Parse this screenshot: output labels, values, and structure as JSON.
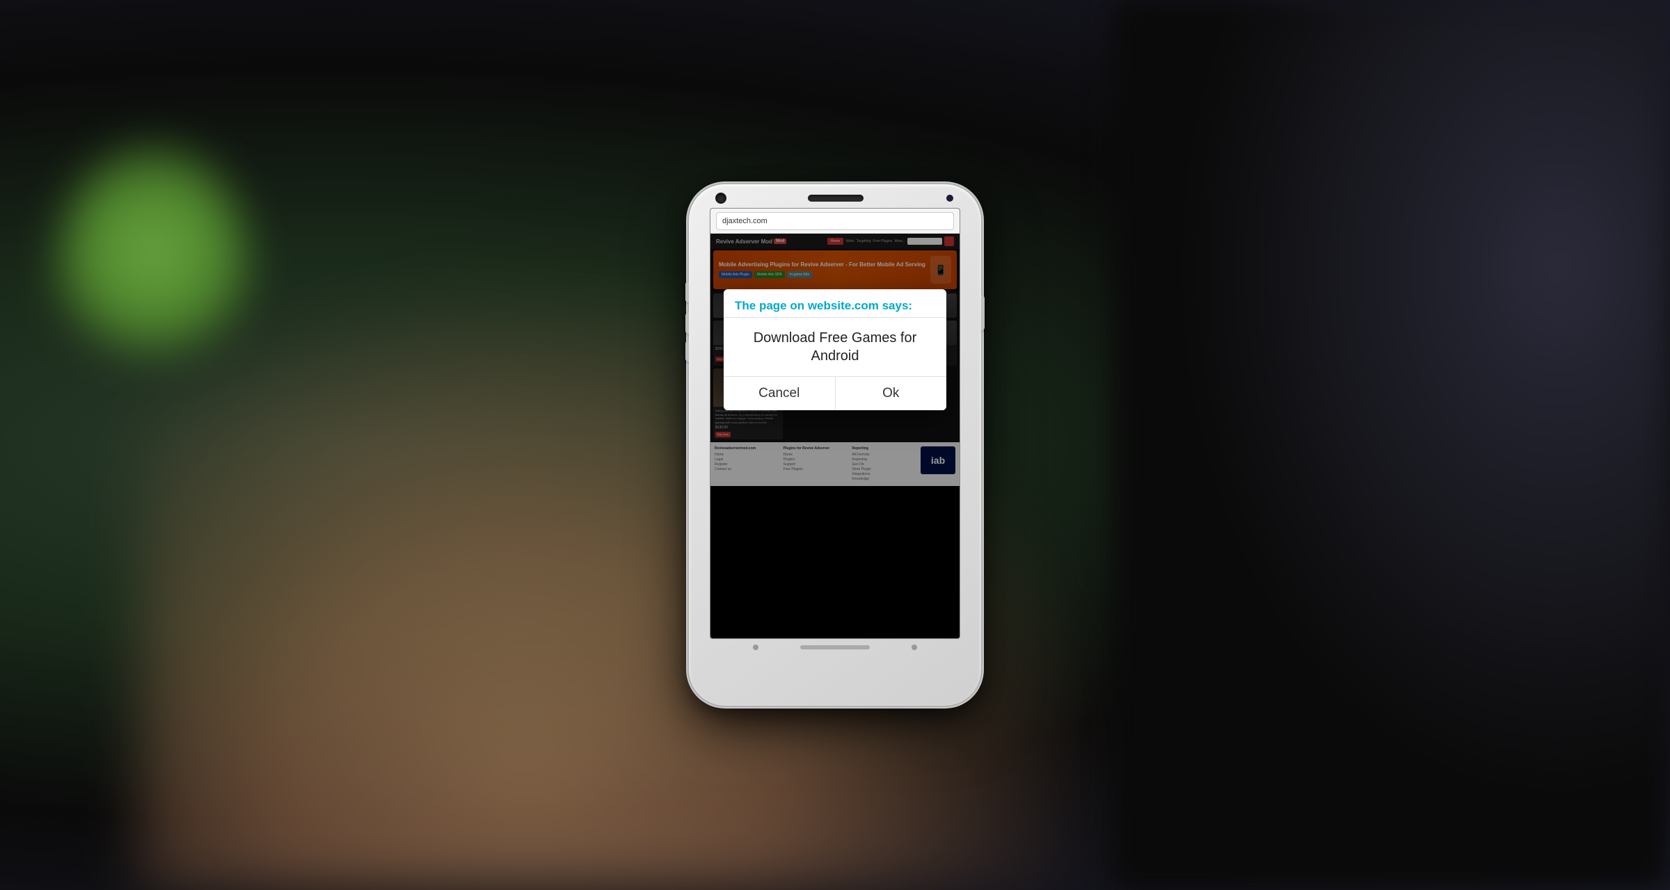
{
  "background": {
    "color": "#1a1a1a"
  },
  "phone": {
    "browser": {
      "address_bar": "djaxtech.com"
    },
    "website": {
      "header": {
        "logo_text": "Revive Adserver Mod",
        "logo_sub": "Plugins for Revive Adserver",
        "badge_text": "Mod",
        "nav_items": [
          "Home",
          "Video",
          "Targeting",
          "Free Plugins",
          "More..."
        ]
      },
      "banner": {
        "title": "Mobile Advertising Plugins for Revive Adserver - For Better Mobile Ad Serving",
        "btn1": "Mobile Ads Plugin",
        "btn2": "Mobile Ads SDK",
        "btn3": "In-game Ads"
      },
      "dialog": {
        "title": "The page on website.com says:",
        "message": "Download Free Games for Android",
        "cancel_label": "Cancel",
        "ok_label": "Ok"
      },
      "footer": {
        "col1_title": "Reviveadservermod.com",
        "col1_links": [
          "Home",
          "Legal",
          "Register",
          "Contact us"
        ],
        "col2_title": "Plugins for Revive Adserver",
        "col2_links": [
          "Home",
          "Plugins",
          "Support",
          "Free Plugins"
        ],
        "col3_title": "Reporting",
        "col3_links": [
          "All Formats",
          "Reporting",
          "Geo Db",
          "Store Plugin",
          "Integrations",
          "Knowledge"
        ]
      }
    }
  }
}
